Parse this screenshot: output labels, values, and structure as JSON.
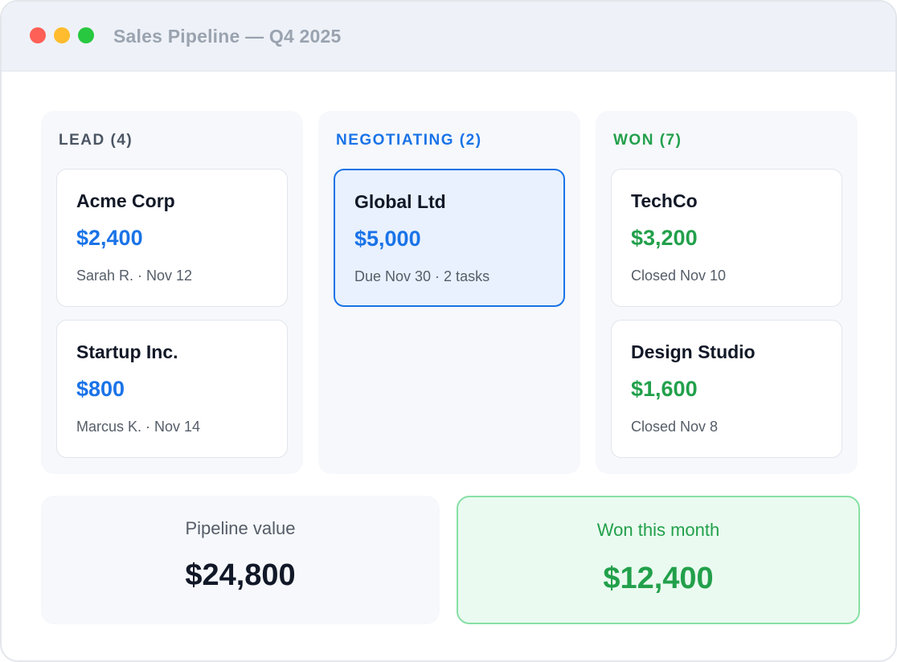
{
  "window": {
    "title": "Sales Pipeline — Q4 2025"
  },
  "columns": [
    {
      "header": "LEAD (4)",
      "cards": [
        {
          "name": "Acme Corp",
          "amount": "$2,400",
          "meta": "Sarah R. · Nov 12"
        },
        {
          "name": "Startup Inc.",
          "amount": "$800",
          "meta": "Marcus K. · Nov 14"
        }
      ]
    },
    {
      "header": "NEGOTIATING (2)",
      "cards": [
        {
          "name": "Global Ltd",
          "amount": "$5,000",
          "meta": "Due Nov 30 · 2 tasks"
        }
      ]
    },
    {
      "header": "WON (7)",
      "cards": [
        {
          "name": "TechCo",
          "amount": "$3,200",
          "meta": "Closed Nov 10"
        },
        {
          "name": "Design Studio",
          "amount": "$1,600",
          "meta": "Closed Nov 8"
        }
      ]
    }
  ],
  "summary": {
    "pipeline_label": "Pipeline value",
    "pipeline_value": "$24,800",
    "won_label": "Won this month",
    "won_value": "$12,400"
  },
  "colors": {
    "accent_blue": "#1a73e8",
    "accent_green": "#22a04b",
    "traffic_red": "#fe5f57",
    "traffic_yellow": "#febc2e",
    "traffic_green": "#28c840"
  }
}
